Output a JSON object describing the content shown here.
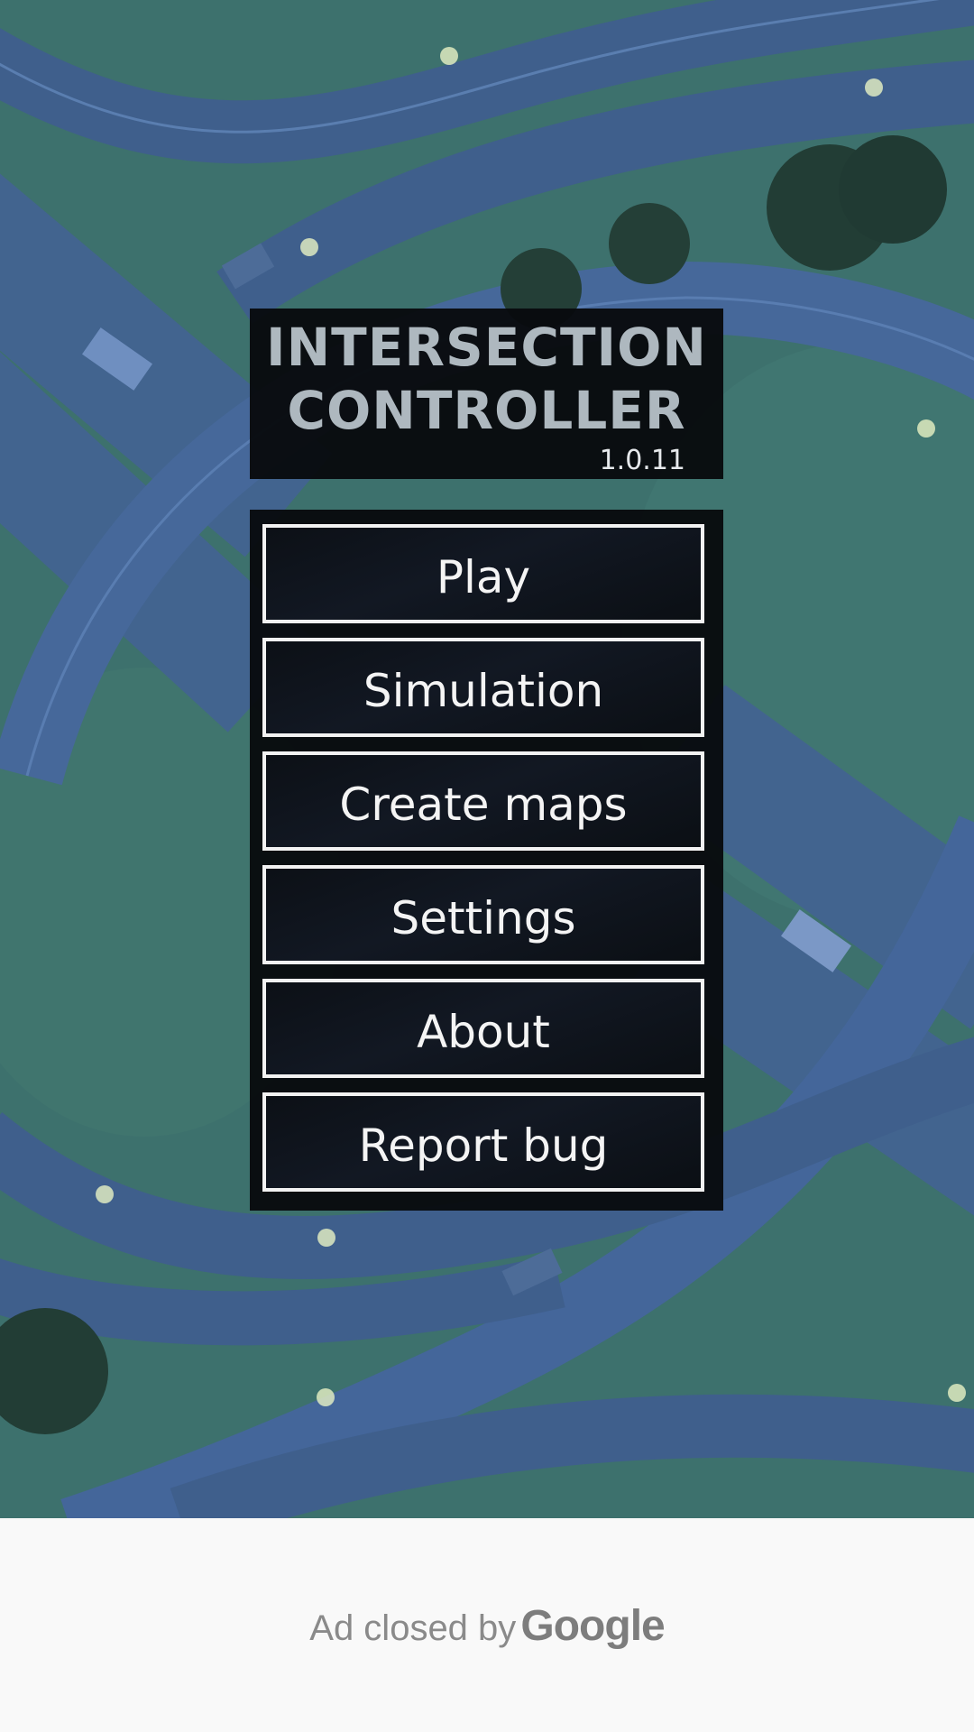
{
  "game": {
    "title": "INTERSECTION\nCONTROLLER",
    "version": "1.0.11"
  },
  "menu": {
    "items": [
      {
        "label": "Play"
      },
      {
        "label": "Simulation"
      },
      {
        "label": "Create maps"
      },
      {
        "label": "Settings"
      },
      {
        "label": "About"
      },
      {
        "label": "Report bug"
      }
    ]
  },
  "ad": {
    "closed_label": "Ad closed by",
    "brand": "Google"
  },
  "colors": {
    "ground": "#3d716d",
    "road": "#3f6290",
    "panel": "#080a0e",
    "button_border": "#f2f2f2",
    "ad_background": "#f9f9f9"
  }
}
